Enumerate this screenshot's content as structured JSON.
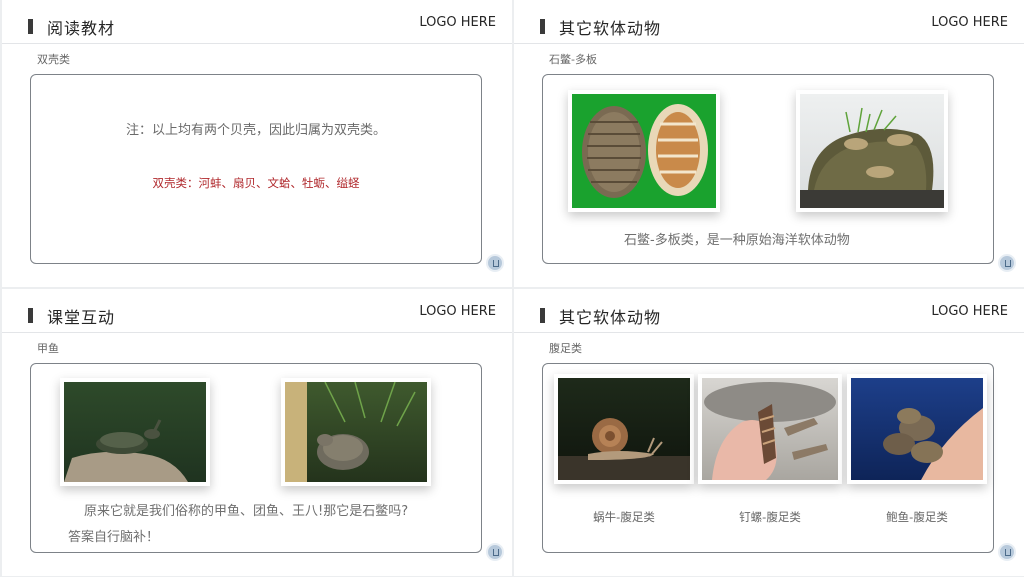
{
  "slides": {
    "reading": {
      "title": "阅读教材",
      "logo": "LOGO HERE",
      "subtitle": "双壳类",
      "note": "注：以上均有两个贝壳，因此归属为双壳类。",
      "list": "双壳类：河蚌、扇贝、文蛤、牡蛎、缢蛏"
    },
    "chiton": {
      "title": "其它软体动物",
      "logo": "LOGO HERE",
      "subtitle": "石鳖-多板",
      "caption": "石鳖-多板类，是一种原始海洋软体动物"
    },
    "turtle": {
      "title": "课堂互动",
      "logo": "LOGO HERE",
      "subtitle": "甲鱼",
      "question_line1": "原来它就是我们俗称的甲鱼、团鱼、王八!那它是石鳖吗?",
      "question_line2": "答案自行脑补！"
    },
    "gastropod": {
      "title": "其它软体动物",
      "logo": "LOGO HERE",
      "subtitle": "腹足类",
      "captions": [
        "蜗牛-腹足类",
        "钉螺-腹足类",
        "鲍鱼-腹足类"
      ]
    }
  },
  "icons": {
    "corner": "presenter-icon",
    "title_marker": "title-bar-icon"
  },
  "colors": {
    "accent_red": "#b0282c",
    "frame": "#7d8288"
  }
}
